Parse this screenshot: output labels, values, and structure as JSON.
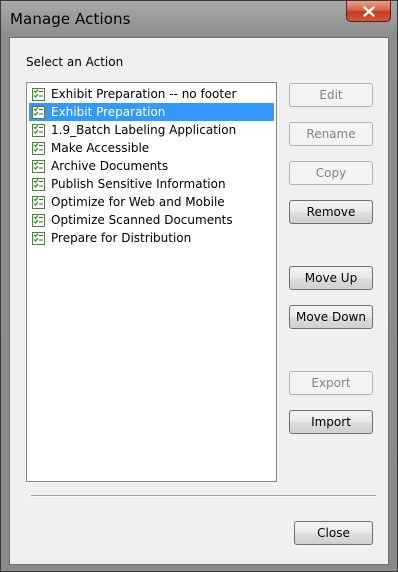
{
  "window": {
    "title": "Manage Actions"
  },
  "dialog": {
    "list_label": "Select an Action",
    "actions": [
      {
        "label": "Exhibit Preparation -- no footer",
        "selected": false
      },
      {
        "label": "Exhibit Preparation",
        "selected": true
      },
      {
        "label": "1.9_Batch Labeling Application",
        "selected": false
      },
      {
        "label": "Make Accessible",
        "selected": false
      },
      {
        "label": "Archive Documents",
        "selected": false
      },
      {
        "label": "Publish Sensitive Information",
        "selected": false
      },
      {
        "label": "Optimize for Web and Mobile",
        "selected": false
      },
      {
        "label": "Optimize Scanned Documents",
        "selected": false
      },
      {
        "label": "Prepare for Distribution",
        "selected": false
      }
    ],
    "buttons": {
      "edit": "Edit",
      "rename": "Rename",
      "copy": "Copy",
      "remove": "Remove",
      "move_up": "Move Up",
      "move_down": "Move Down",
      "export": "Export",
      "import": "Import",
      "close": "Close"
    }
  },
  "colors": {
    "selection": "#3399ff",
    "disabled_text": "#838383"
  },
  "icons": {
    "list_item": "checklist-icon",
    "window_close": "close-icon"
  }
}
